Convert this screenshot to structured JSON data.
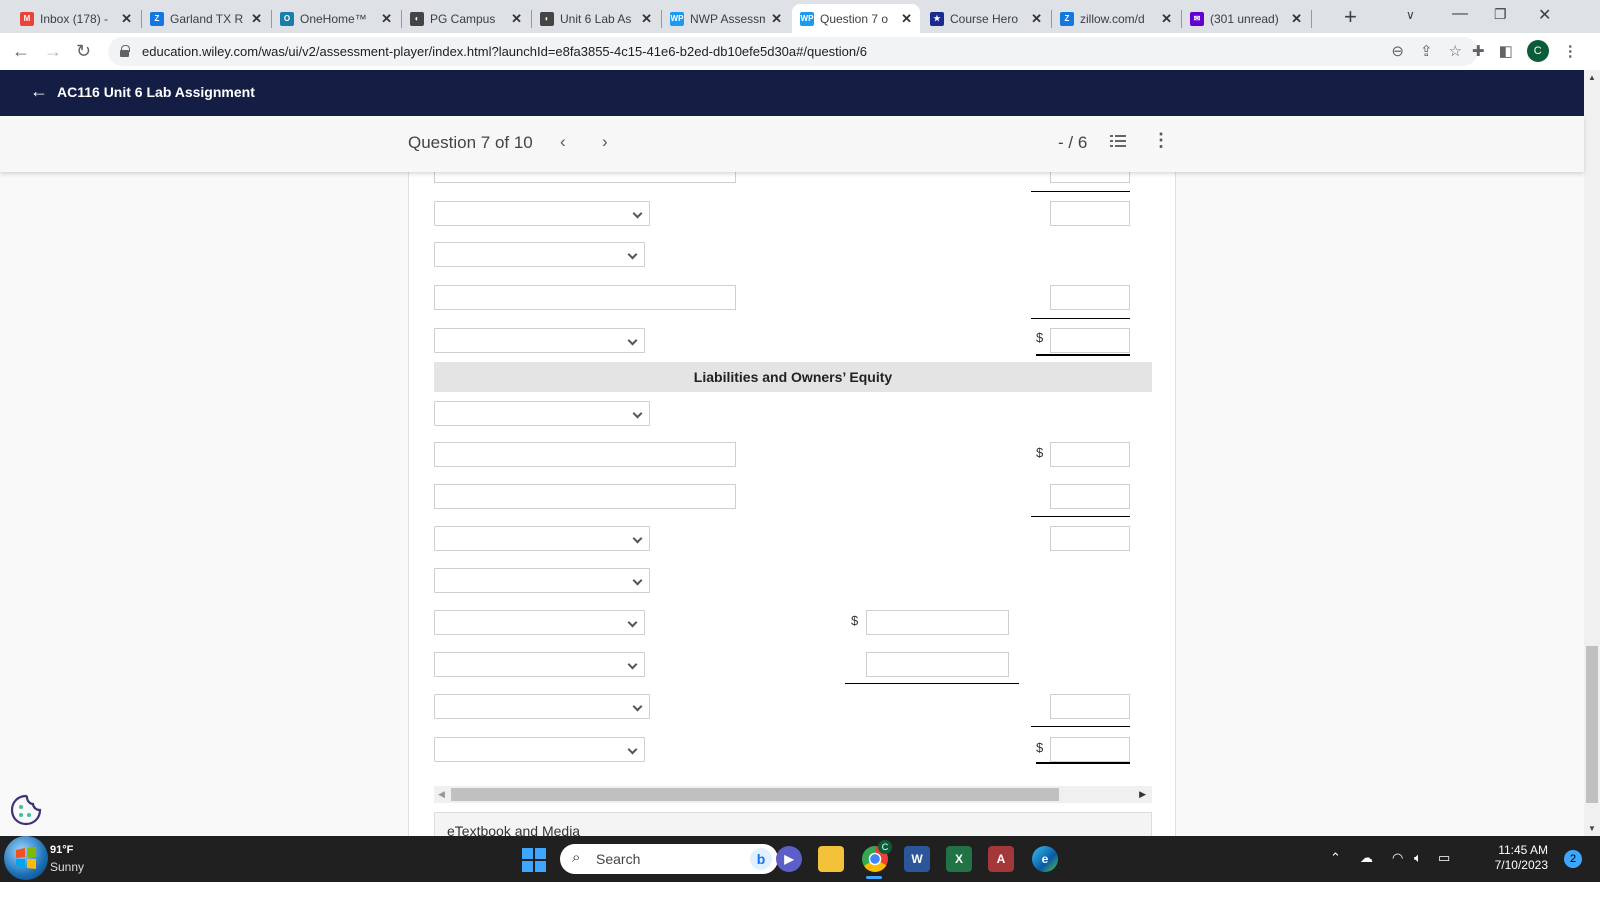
{
  "browser": {
    "tabs": [
      {
        "title": "Inbox (178) -",
        "icon": "gmail-icon",
        "color": "#ea4335",
        "glyph": "M"
      },
      {
        "title": "Garland TX R",
        "icon": "zillow-icon",
        "color": "#1277e1",
        "glyph": "Z"
      },
      {
        "title": "OneHome™",
        "icon": "onehome-icon",
        "color": "#1a7fa6",
        "glyph": "O"
      },
      {
        "title": "PG Campus",
        "icon": "campus-icon",
        "color": "#444444",
        "glyph": "◐"
      },
      {
        "title": "Unit 6 Lab As",
        "icon": "campus-icon",
        "color": "#444444",
        "glyph": "◐"
      },
      {
        "title": "NWP Assessm",
        "icon": "wileyplus-icon",
        "color": "#1a9bf0",
        "glyph": "WP"
      },
      {
        "title": "Question 7 o",
        "icon": "wileyplus-icon",
        "color": "#1a9bf0",
        "glyph": "WP",
        "active": true
      },
      {
        "title": "Course Hero",
        "icon": "coursehero-icon",
        "color": "#1b2a8f",
        "glyph": "★"
      },
      {
        "title": "zillow.com/d",
        "icon": "zillow-icon",
        "color": "#1277e1",
        "glyph": "Z"
      },
      {
        "title": "(301 unread)",
        "icon": "yahoo-mail-icon",
        "color": "#6001d2",
        "glyph": "✉"
      }
    ],
    "url": "education.wiley.com/was/ui/v2/assessment-player/index.html?launchId=e8fa3855-4c15-41e6-b2ed-db10efe5d30a#/question/6",
    "profile_initial": "C"
  },
  "app": {
    "assignment_title": "AC116 Unit 6 Lab Assignment",
    "question_label": "Question 7 of 10",
    "score": "- / 6"
  },
  "form": {
    "section_heading": "Liabilities and Owners’ Equity",
    "currency_symbol": "$",
    "etextbook_label": "eTextbook and Media"
  },
  "taskbar": {
    "weather_temp": "91°F",
    "weather_desc": "Sunny",
    "search_placeholder": "Search",
    "time": "11:45 AM",
    "date": "7/10/2023",
    "notification_count": "2",
    "chrome_badge": "C"
  }
}
